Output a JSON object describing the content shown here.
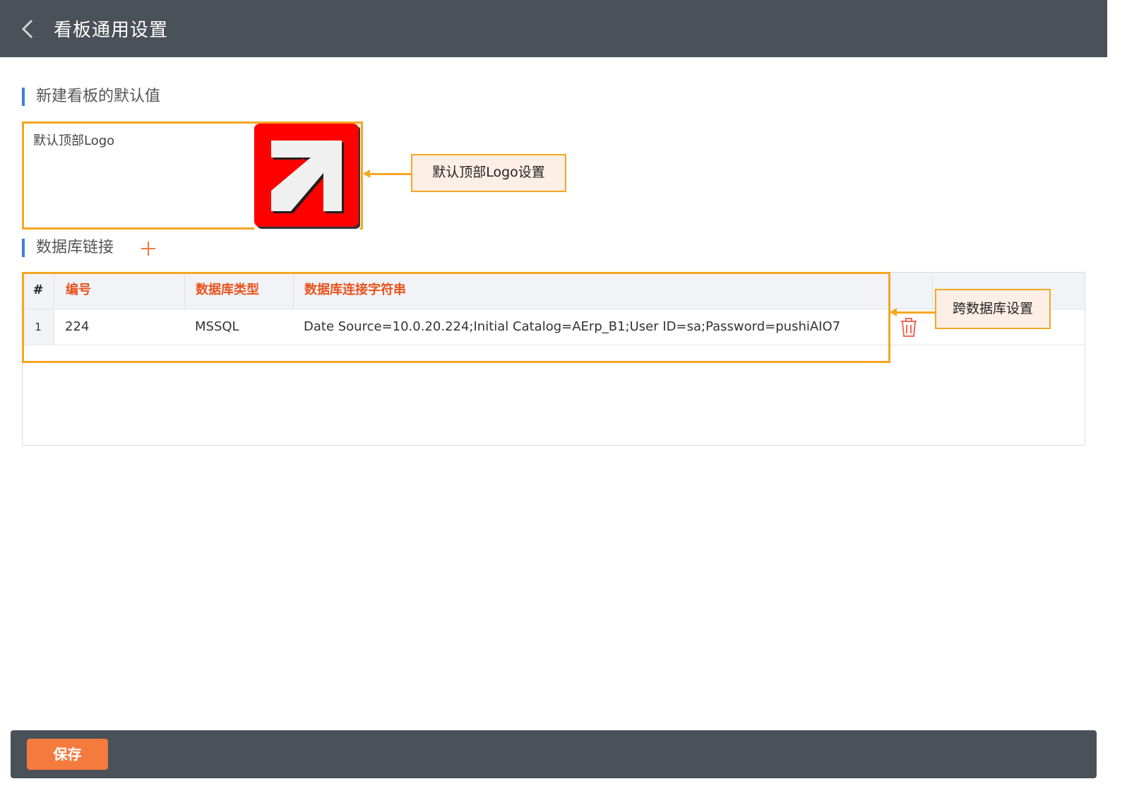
{
  "header": {
    "title": "看板通用设置",
    "back_icon": "chevron-left-icon"
  },
  "sections": {
    "defaults_title": "新建看板的默认值",
    "db_title": "数据库链接"
  },
  "logo": {
    "label": "默认顶部Logo",
    "image": "red-arrow-logo"
  },
  "callouts": {
    "logo": "默认顶部Logo设置",
    "db": "跨数据库设置"
  },
  "table": {
    "columns": [
      "#",
      "编号",
      "数据库类型",
      "数据库连接字符串"
    ],
    "rows": [
      {
        "index": "1",
        "id": "224",
        "type": "MSSQL",
        "conn": "Date Source=10.0.20.224;Initial Catalog=AErp_B1;User ID=sa;Password=pushiAIO7"
      }
    ]
  },
  "footer": {
    "save_label": "保存"
  },
  "colors": {
    "topbar": "#4b5159",
    "accent": "#f47a3e",
    "header_text": "#e8541e",
    "highlight": "#f5a623",
    "section_bar": "#3a7fe0"
  }
}
